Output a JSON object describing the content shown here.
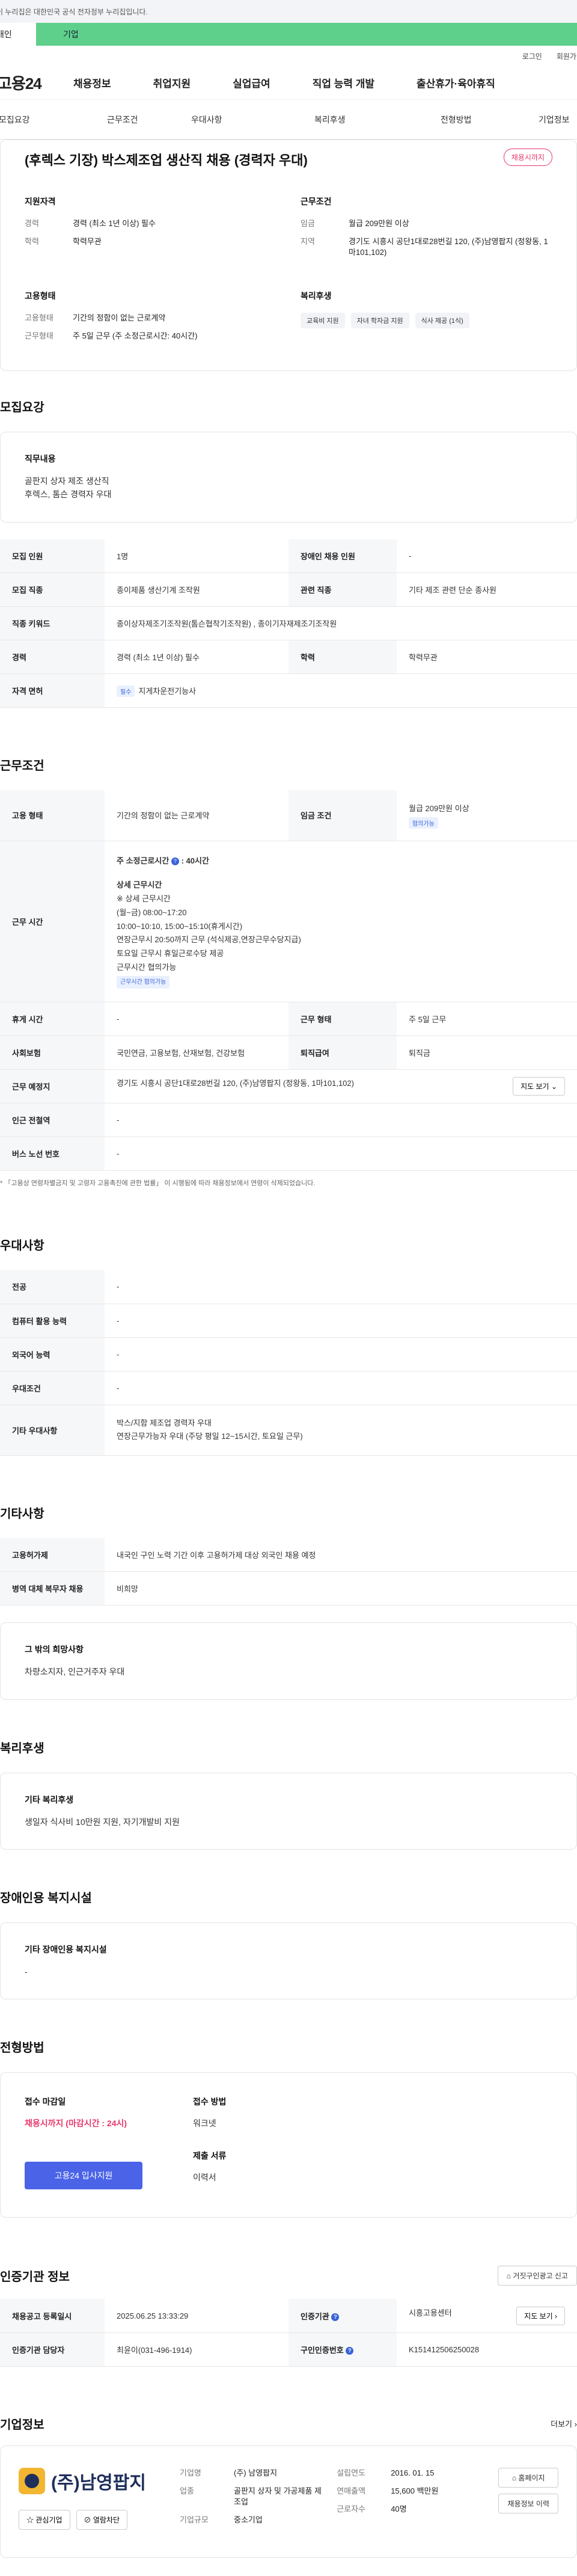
{
  "banner": {
    "text": "이 누리집은 대한민국 공식 전자정부 누리집입니다."
  },
  "top_tabs": {
    "personal": "개인",
    "company": "기업"
  },
  "util": {
    "login": "로그인",
    "join": "회원가입"
  },
  "gnb": {
    "logo": "고용24",
    "items": [
      "채용정보",
      "취업지원",
      "실업급여",
      "직업 능력 개발",
      "출산휴가·육아휴직"
    ]
  },
  "subnav": [
    "모집요강",
    "근무조건",
    "우대사항",
    "복리후생",
    "전형방법",
    "기업정보"
  ],
  "summary": {
    "title": "(후렉스 기장) 박스제조업 생산직 채용 (경력자 우대)",
    "badge": "채용시까지",
    "qual_title": "지원자격",
    "qual": [
      {
        "k": "경력",
        "v": "경력 (최소 1년 이상) 필수"
      },
      {
        "k": "학력",
        "v": "학력무관"
      }
    ],
    "cond_title": "근무조건",
    "cond": [
      {
        "k": "임금",
        "v": "월급 209만원 이상"
      },
      {
        "k": "지역",
        "v": "경기도 시흥시 공단1대로28번길 120, (주)남영팝지 (정왕동, 1마101,102)"
      }
    ],
    "emp_title": "고용형태",
    "emp": [
      {
        "k": "고용형태",
        "v": "기간의 정함이 없는 근로계약"
      },
      {
        "k": "근무형태",
        "v": "주 5일 근무 (주 소정근로시간: 40시간)"
      }
    ],
    "welfare_title": "복리후생",
    "welfare_chips": [
      "교육비 지원",
      "자녀 학자금 지원",
      "식사 제공 (1식)"
    ]
  },
  "recruit": {
    "section_title": "모집요강",
    "duty_title": "직무내용",
    "duty_lines": [
      "골판지 상자 제조 생산직",
      "후렉스, 톰슨 경력자 우대"
    ],
    "rows": {
      "headcount_label": "모집 인원",
      "headcount": "1명",
      "disabled_label": "장애인 채용 인원",
      "disabled": "-",
      "job_label": "모집 직종",
      "job": "종이제품 생산기계 조작원",
      "related_label": "관련 직종",
      "related": "기타 제조 관련 단순 종사원",
      "keyword_label": "직종 키워드",
      "keyword": "종이상자제조기조작원(톰슨협착기조작원) , 종이기자재제조기조작원",
      "career_label": "경력",
      "career": "경력 (최소 1년 이상) 필수",
      "edu_label": "학력",
      "edu": "학력무관",
      "license_label": "자격 면허",
      "license_tag": "필수",
      "license": "지게차운전기능사"
    }
  },
  "work": {
    "section_title": "근무조건",
    "type_label": "고용 형태",
    "type": "기간의 정함이 없는 근로계약",
    "wage_label": "임금 조건",
    "wage": "월급 209만원 이상",
    "wage_tag": "협의가능",
    "time_label": "근무 시간",
    "time_head": "주 소정근로시간",
    "time_hours": ": 40시간",
    "time_detail_title": "상세 근무시간",
    "time_lines": [
      "※ 상세 근무시간",
      "(월~금) 08:00~17:20",
      "10:00~10:10, 15:00~15:10(휴게시간)",
      "연장근무시 20:50까지 근무 (석식제공,연장근무수당지급)",
      "토요일 근무시 휴일근로수당 제공",
      "근무시간 협의가능"
    ],
    "time_tag": "근무시간 협의가능",
    "break_label": "휴게 시간",
    "break": "-",
    "shift_label": "근무 형태",
    "shift": "주 5일 근무",
    "insurance_label": "사회보험",
    "insurance": "국민연금, 고용보험, 산재보험, 건강보험",
    "severance_label": "퇴직급여",
    "severance": "퇴직금",
    "location_label": "근무 예정지",
    "location": "경기도 시흥시 공단1대로28번길 120, (주)남영팝지 (정왕동, 1마101,102)",
    "map_btn": "지도 보기",
    "subway_label": "인근 전철역",
    "subway": "-",
    "bus_label": "버스 노선 번호",
    "bus": "-",
    "note": "* 「고용상 연령차별금지 및 고령자 고용촉진에 관한 법률」 이 시행됨에 따라 채용정보에서 연령이 삭제되었습니다."
  },
  "pref": {
    "section_title": "우대사항",
    "major_label": "전공",
    "major": "-",
    "computer_label": "컴퓨터 활용 능력",
    "computer": "-",
    "lang_label": "외국어 능력",
    "lang": "-",
    "cond_label": "우대조건",
    "cond": "-",
    "etc_label": "기타 우대사항",
    "etc_lines": [
      "박스/지함 제조업 경력자 우대",
      "연장근무가능자 우대 (주당 평일 12~15시간, 토요일 근무)"
    ]
  },
  "other": {
    "section_title": "기타사항",
    "foreign_label": "고용허가제",
    "foreign": "내국인 구인 노력 기간 이후 고용허가제 대상 외국인 채용 예정",
    "military_label": "병역 대체 복무자 채용",
    "military": "비희망",
    "wish_title": "그 밖의 희망사항",
    "wish": "차량소지자, 인근거주자 우대"
  },
  "welfare": {
    "section_title": "복리후생",
    "title": "기타 복리후생",
    "text": "생일자 식사비 10만원 지원, 자기개발비 지원"
  },
  "disabled_fac": {
    "section_title": "장애인용 복지시설",
    "title": "기타 장애인용 복지시설",
    "text": "-"
  },
  "apply": {
    "section_title": "전형방법",
    "deadline_title": "접수 마감일",
    "deadline": "채용시까지 (마감시간 : 24시)",
    "method_title": "접수 방법",
    "method": "워크넷",
    "docs_title": "제출 서류",
    "docs": "이력서",
    "button": "고용24 입사지원"
  },
  "agency": {
    "section_title": "인증기관 정보",
    "report_btn": "거짓구인광고 신고",
    "reg_label": "채용공고 등록일시",
    "reg": "2025.06.25 13:33:29",
    "agency_label": "인증기관",
    "agency": "시흥고용센터",
    "map_btn": "지도 보기",
    "manager_label": "인증기관 담당자",
    "manager": "최윤이(031-496-1914)",
    "number_label": "구인인증번호",
    "number": "K151412506250028"
  },
  "company": {
    "section_title": "기업정보",
    "more": "더보기",
    "logo_text": "(주)남영팝지",
    "fav_btn": "관심기업",
    "block_btn": "열람차단",
    "name_label": "기업명",
    "name": "(주) 남영팝지",
    "industry_label": "업종",
    "industry": "골판지 상자 및 가공제품 제조업",
    "size_label": "기업규모",
    "size": "중소기업",
    "founded_label": "설립연도",
    "founded": "2016. 01. 15",
    "sales_label": "연매출액",
    "sales": "15,600 백만원",
    "employees_label": "근로자수",
    "employees": "40명",
    "homepage_btn": "홈페이지",
    "history_btn": "채용정보 이력"
  }
}
